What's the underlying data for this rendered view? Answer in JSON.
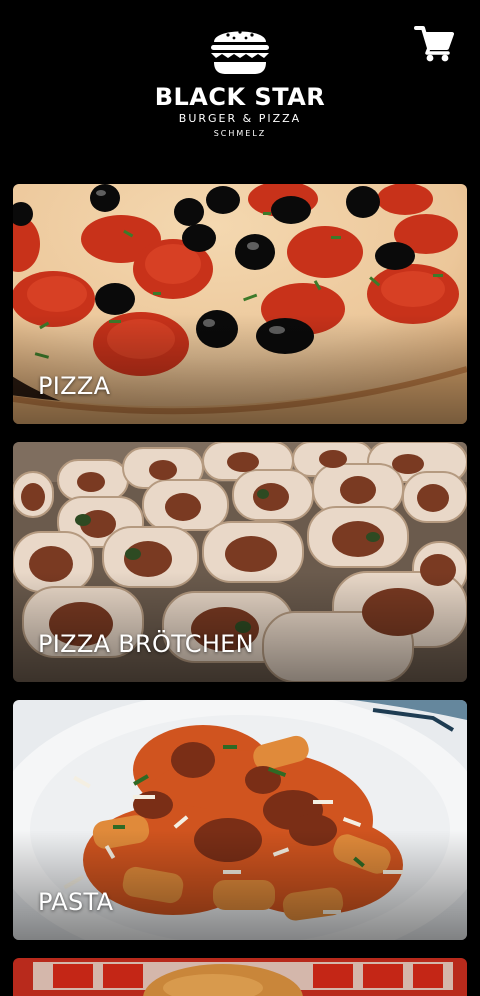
{
  "header": {
    "brand_name": "BLACK STAR",
    "brand_subtitle": "BURGER & PIZZA",
    "brand_location": "SCHMELZ",
    "logo_icon": "burger-icon",
    "cart_icon": "shopping-cart-icon"
  },
  "categories": [
    {
      "label": "PIZZA",
      "image": "pizza-photo"
    },
    {
      "label": "PIZZA BRÖTCHEN",
      "image": "pizza-rolls-photo"
    },
    {
      "label": "PASTA",
      "image": "pasta-photo"
    },
    {
      "label": "",
      "image": "burger-photo"
    }
  ],
  "colors": {
    "background": "#000000",
    "text": "#ffffff",
    "pizza_red": "#c43a1c",
    "olive": "#0d0d0d"
  }
}
